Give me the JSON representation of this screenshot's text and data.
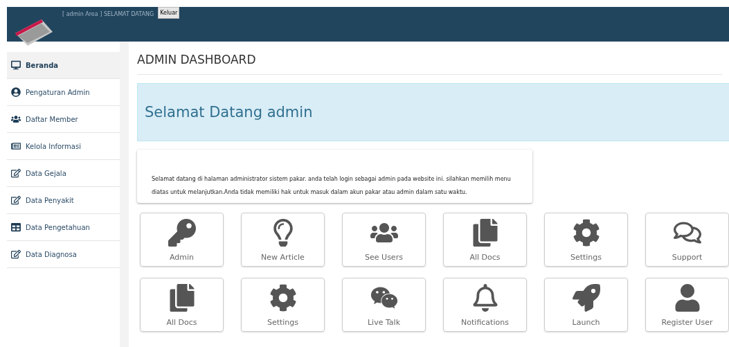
{
  "header": {
    "greeting": "[ admin Area ] SELAMAT DATANG",
    "logout_button": "Keluar"
  },
  "sidebar": {
    "items": [
      {
        "label": "Beranda",
        "selected": true
      },
      {
        "label": "Pengaturan Admin",
        "selected": false
      },
      {
        "label": "Daftar Member",
        "selected": false
      },
      {
        "label": "Kelola Informasi",
        "selected": false
      },
      {
        "label": "Data Gejala",
        "selected": false
      },
      {
        "label": "Data Penyakit",
        "selected": false
      },
      {
        "label": "Data Pengetahuan",
        "selected": false
      },
      {
        "label": "Data Diagnosa",
        "selected": false
      }
    ]
  },
  "page_title": "ADMIN DASHBOARD",
  "welcome_alert": "Selamat Datang admin",
  "info_panel": "Selamat datang di halaman administrator sistem pakar. anda telah login sebagai admin pada website ini. silahkan memilih menu diatas untuk melanjutkan.Anda tidak memiliki hak untuk masuk dalam akun pakar atau admin dalam satu waktu.",
  "tiles": [
    {
      "label": "Admin"
    },
    {
      "label": "New Article"
    },
    {
      "label": "See Users"
    },
    {
      "label": "All Docs"
    },
    {
      "label": "Settings"
    },
    {
      "label": "Support"
    },
    {
      "label": "All Docs"
    },
    {
      "label": "Settings"
    },
    {
      "label": "Live Talk"
    },
    {
      "label": "Notifications"
    },
    {
      "label": "Launch"
    },
    {
      "label": "Register User"
    }
  ]
}
